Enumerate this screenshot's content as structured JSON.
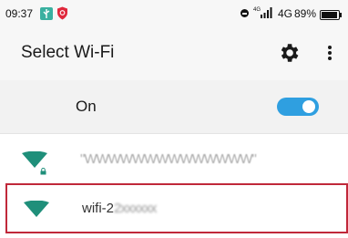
{
  "status_bar": {
    "time": "09:37",
    "network_type": "4G",
    "battery": "89%",
    "icons": [
      "usb-icon",
      "shield-icon",
      "dnd-icon",
      "signal-icon",
      "battery-icon"
    ]
  },
  "header": {
    "title": "Select Wi-Fi",
    "settings_icon": "gear-icon",
    "more_icon": "more-vertical-icon"
  },
  "wifi_toggle": {
    "label": "On",
    "enabled": true
  },
  "networks": [
    {
      "ssid": "\"WWWWWWWWWWWWWW\"",
      "secured": true
    },
    {
      "ssid_prefix": "wifi-2",
      "ssid_obscured": "2xxxxxx",
      "secured": false,
      "selected": true
    }
  ],
  "colors": {
    "accent": "#2f9fe0",
    "wifi_icon": "#1f8f7a",
    "selection_border": "#c0283a"
  }
}
